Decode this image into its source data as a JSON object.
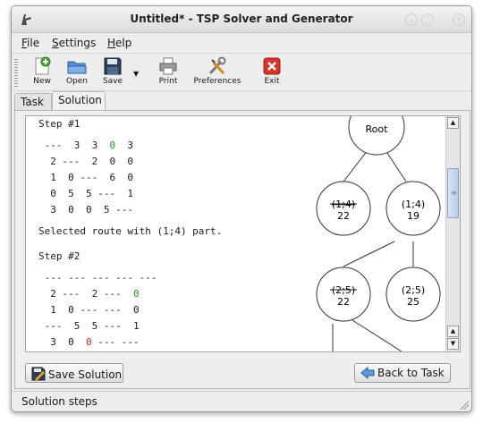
{
  "window": {
    "title": "Untitled* - TSP Solver and Generator"
  },
  "menu": [
    {
      "label": "File",
      "accel": "F",
      "rest": "ile"
    },
    {
      "label": "Settings",
      "accel": "S",
      "rest": "ettings"
    },
    {
      "label": "Help",
      "accel": "H",
      "rest": "elp"
    }
  ],
  "toolbar": {
    "new": "New",
    "open": "Open",
    "save": "Save",
    "print": "Print",
    "preferences": "Preferences",
    "exit": "Exit"
  },
  "tabs": {
    "task": "Task",
    "solution": "Solution"
  },
  "solution": {
    "step1": {
      "title": "Step #1",
      "rows": [
        [
          " ---",
          "  3",
          "  3",
          "  0",
          "  3"
        ],
        [
          "  2",
          " ---",
          "  2",
          "  0",
          "  0"
        ],
        [
          "  1",
          "  0",
          " ---",
          "  6",
          "  0"
        ],
        [
          "  0",
          "  5",
          "  5",
          " ---",
          "  1"
        ],
        [
          "  3",
          "  0",
          "  0",
          "  5",
          " ---"
        ]
      ],
      "note": "Selected route with (1;4) part."
    },
    "step2": {
      "title": "Step #2",
      "rows": [
        [
          " ---",
          " ---",
          " ---",
          " ---",
          " ---"
        ],
        [
          "  2",
          " ---",
          "  2",
          " ---",
          "  0"
        ],
        [
          "  1",
          "  0",
          " ---",
          " ---",
          "  0"
        ],
        [
          " ---",
          "  5",
          "  5",
          " ---",
          "  1"
        ],
        [
          "  3",
          "  0",
          "  0",
          " ---",
          " ---"
        ]
      ]
    },
    "tree": {
      "root": "Root",
      "n1_label": "(1;4)",
      "n1_value": "22",
      "n2_label": "(1;4)",
      "n2_value": "19",
      "n3_label": "(2;5)",
      "n3_value": "22",
      "n4_label": "(2;5)",
      "n4_value": "25"
    }
  },
  "buttons": {
    "save_solution": "Save Solution",
    "back_to_task": "Back to Task"
  },
  "status": {
    "text": "Solution steps"
  }
}
